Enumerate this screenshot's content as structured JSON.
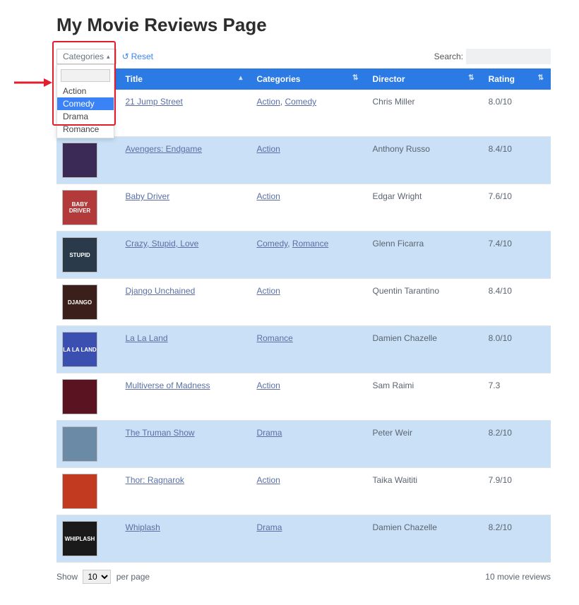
{
  "page": {
    "title": "My Movie Reviews Page"
  },
  "controls": {
    "categories_button_label": "Categories",
    "reset_label": "Reset",
    "search_label": "Search:",
    "search_value": "",
    "dropdown": {
      "filter_value": "",
      "options": [
        "Action",
        "Comedy",
        "Drama",
        "Romance"
      ],
      "highlighted_index": 1
    }
  },
  "columns": {
    "title": "Title",
    "categories": "Categories",
    "director": "Director",
    "rating": "Rating"
  },
  "rows": [
    {
      "title": "21 Jump Street",
      "categories": [
        "Action",
        "Comedy"
      ],
      "director": "Chris Miller",
      "rating": "8.0/10",
      "thumb_bg": "#9aa4ae",
      "thumb_text": ""
    },
    {
      "title": "Avengers: Endgame",
      "categories": [
        "Action"
      ],
      "director": "Anthony Russo",
      "rating": "8.4/10",
      "thumb_bg": "#3b2a55",
      "thumb_text": ""
    },
    {
      "title": "Baby Driver",
      "categories": [
        "Action"
      ],
      "director": "Edgar Wright",
      "rating": "7.6/10",
      "thumb_bg": "#b33a3a",
      "thumb_text": "BABY DRIVER"
    },
    {
      "title": "Crazy, Stupid, Love",
      "categories": [
        "Comedy",
        "Romance"
      ],
      "director": "Glenn Ficarra",
      "rating": "7.4/10",
      "thumb_bg": "#2a3a4a",
      "thumb_text": "STUPID"
    },
    {
      "title": "Django Unchained",
      "categories": [
        "Action"
      ],
      "director": "Quentin Tarantino",
      "rating": "8.4/10",
      "thumb_bg": "#3a1f1a",
      "thumb_text": "DJANGO"
    },
    {
      "title": "La La Land",
      "categories": [
        "Romance"
      ],
      "director": "Damien Chazelle",
      "rating": "8.0/10",
      "thumb_bg": "#3b4fb0",
      "thumb_text": "LA LA LAND"
    },
    {
      "title": "Multiverse of Madness",
      "categories": [
        "Action"
      ],
      "director": "Sam Raimi",
      "rating": "7.3",
      "thumb_bg": "#5a1320",
      "thumb_text": ""
    },
    {
      "title": "The Truman Show",
      "categories": [
        "Drama"
      ],
      "director": "Peter Weir",
      "rating": "8.2/10",
      "thumb_bg": "#6a8aa6",
      "thumb_text": ""
    },
    {
      "title": "Thor: Ragnarok",
      "categories": [
        "Action"
      ],
      "director": "Taika Waititi",
      "rating": "7.9/10",
      "thumb_bg": "#c23a1f",
      "thumb_text": ""
    },
    {
      "title": "Whiplash",
      "categories": [
        "Drama"
      ],
      "director": "Damien Chazelle",
      "rating": "8.2/10",
      "thumb_bg": "#1a1a1a",
      "thumb_text": "WHIPLASH"
    }
  ],
  "footer": {
    "show_label": "Show",
    "per_page_label": "per page",
    "page_size": "10",
    "summary": "10 movie reviews"
  }
}
